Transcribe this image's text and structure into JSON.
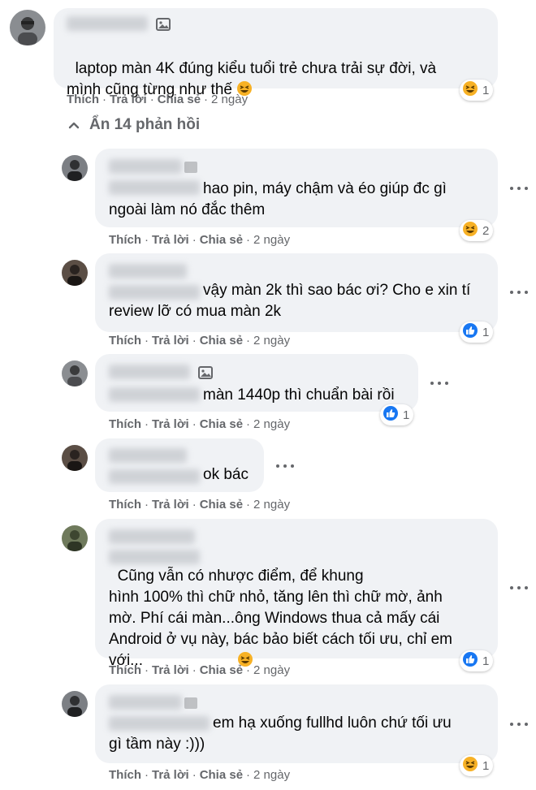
{
  "actions": {
    "like": "Thích",
    "reply": "Trả lời",
    "share": "Chia sẻ",
    "sep": "·"
  },
  "main_comment": {
    "text": "laptop màn 4K đúng kiểu tuổi trẻ chưa trải sự đời, và\nmình cũng từng như thế",
    "time": "2 ngày",
    "reaction": "haha",
    "reaction_count": "1"
  },
  "hide_replies": "Ẩn 14 phản hồi",
  "replies": [
    {
      "text": "hao pin, máy chậm và éo giúp đc gì\nngoài làm nó đắc thêm",
      "time": "2 ngày",
      "reaction": "haha",
      "reaction_count": "2"
    },
    {
      "text": "vậy màn 2k thì sao bác ơi? Cho e xin tí\nreview lỡ có mua màn 2k",
      "time": "2 ngày",
      "reaction": "like",
      "reaction_count": "1"
    },
    {
      "text": "màn 1440p thì chuẩn bài rồi",
      "time": "2 ngày",
      "reaction": "like",
      "reaction_count": "1"
    },
    {
      "text": "ok bác",
      "time": "2 ngày"
    },
    {
      "text": "Cũng vẫn có nhược điểm, để khung\nhình 100% thì chữ nhỏ, tăng lên thì chữ mờ, ảnh\nmờ. Phí cái màn...ông Windows thua cả mấy cái\nAndroid ở vụ này, bác bảo biết cách tối ưu, chỉ em\nvới...",
      "time": "2 ngày",
      "reaction": "like",
      "reaction_count": "1"
    },
    {
      "text": "em hạ xuống fullhd luôn chứ tối ưu\ngì tầm này :)))",
      "time": "2 ngày",
      "reaction": "haha",
      "reaction_count": "1"
    }
  ],
  "colors": {
    "bubble": "#f0f2f5",
    "meta": "#65676b",
    "like_blue": "#1877f2",
    "haha_yellow": "#f7b125"
  }
}
